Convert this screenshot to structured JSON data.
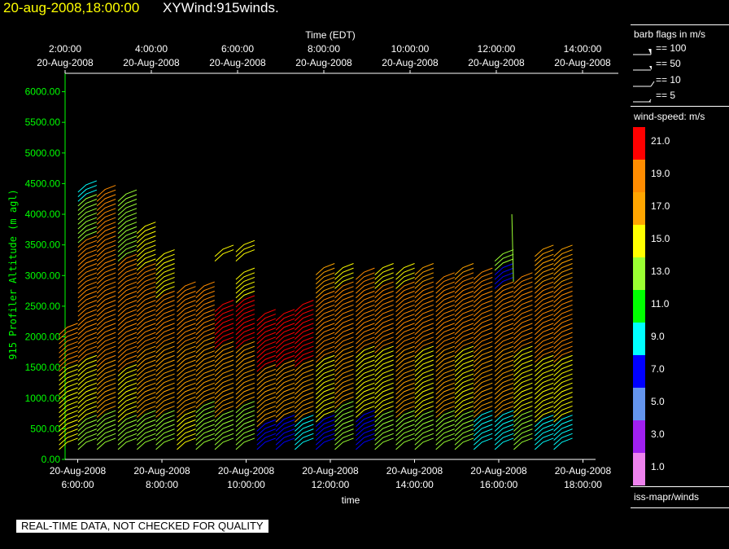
{
  "header": {
    "datetime": "20-aug-2008,18:00:00",
    "product": "XYWind:915winds."
  },
  "colors": {
    "background": "#000000",
    "axis": "#ffffff",
    "yaxis": "#00ff00",
    "title_date": "#ffff00"
  },
  "chart_data": {
    "type": "wind_barbs",
    "top_axis": {
      "title": "Time (EDT)",
      "ticks": [
        {
          "time": "2:00:00",
          "date": "20-Aug-2008"
        },
        {
          "time": "4:00:00",
          "date": "20-Aug-2008"
        },
        {
          "time": "6:00:00",
          "date": "20-Aug-2008"
        },
        {
          "time": "8:00:00",
          "date": "20-Aug-2008"
        },
        {
          "time": "10:00:00",
          "date": "20-Aug-2008"
        },
        {
          "time": "12:00:00",
          "date": "20-Aug-2008"
        },
        {
          "time": "14:00:00",
          "date": "20-Aug-2008"
        }
      ]
    },
    "bottom_axis": {
      "title": "time",
      "ticks": [
        {
          "date": "20-Aug-2008",
          "time": "6:00:00"
        },
        {
          "date": "20-Aug-2008",
          "time": "8:00:00"
        },
        {
          "date": "20-Aug-2008",
          "time": "10:00:00"
        },
        {
          "date": "20-Aug-2008",
          "time": "12:00:00"
        },
        {
          "date": "20-Aug-2008",
          "time": "14:00:00"
        },
        {
          "date": "20-Aug-2008",
          "time": "16:00:00"
        },
        {
          "date": "20-Aug-2008",
          "time": "18:00:00"
        }
      ],
      "xlim_hours": [
        5.7,
        18.3
      ]
    },
    "y_axis": {
      "label": "915 Profiler Altitude (m agl)",
      "ticks": [
        "0.00",
        "500.00",
        "1000.00",
        "1500.00",
        "2000.00",
        "2500.00",
        "3000.00",
        "3500.00",
        "4000.00",
        "4500.00",
        "5000.00",
        "5500.00",
        "6000.00"
      ],
      "ylim": [
        0,
        6300
      ]
    },
    "profiles": [
      {
        "t": 5.75,
        "top": 2200,
        "zones": [
          [
            0,
            1500,
            15
          ],
          [
            1500,
            2200,
            18
          ]
        ]
      },
      {
        "t": 6.2,
        "top": 4500,
        "zones": [
          [
            0,
            700,
            13
          ],
          [
            700,
            1700,
            15
          ],
          [
            1700,
            3600,
            18
          ],
          [
            3600,
            4300,
            13
          ],
          [
            4300,
            4500,
            9
          ]
        ]
      },
      {
        "t": 6.65,
        "top": 4450,
        "zones": [
          [
            0,
            800,
            13
          ],
          [
            800,
            1600,
            16
          ],
          [
            1600,
            3400,
            19
          ],
          [
            3400,
            4450,
            18
          ]
        ]
      },
      {
        "t": 7.15,
        "top": 4400,
        "zones": [
          [
            0,
            700,
            13
          ],
          [
            700,
            1500,
            15
          ],
          [
            1500,
            3300,
            18
          ],
          [
            3300,
            3900,
            13
          ],
          [
            3900,
            4400,
            12
          ]
        ]
      },
      {
        "t": 7.6,
        "top": 3850,
        "zones": [
          [
            0,
            800,
            13
          ],
          [
            800,
            1800,
            16
          ],
          [
            1800,
            3200,
            18
          ],
          [
            3200,
            3850,
            14
          ]
        ]
      },
      {
        "t": 8.05,
        "top": 3400,
        "zones": [
          [
            0,
            800,
            13
          ],
          [
            800,
            1900,
            16
          ],
          [
            1900,
            2700,
            18
          ],
          [
            2700,
            3400,
            15
          ]
        ]
      },
      {
        "t": 8.55,
        "top": 2850,
        "zones": [
          [
            0,
            800,
            14
          ],
          [
            800,
            1900,
            17
          ],
          [
            1900,
            2850,
            19
          ]
        ]
      },
      {
        "t": 9.0,
        "top": 2900,
        "zones": [
          [
            0,
            900,
            13
          ],
          [
            900,
            2000,
            17
          ],
          [
            2000,
            2900,
            18
          ]
        ]
      },
      {
        "t": 9.45,
        "top": 3500,
        "zones": [
          [
            0,
            800,
            13
          ],
          [
            800,
            1900,
            17
          ],
          [
            1900,
            2600,
            21
          ],
          [
            3300,
            3500,
            15
          ]
        ]
      },
      {
        "t": 9.95,
        "top": 3550,
        "zones": [
          [
            0,
            900,
            13
          ],
          [
            900,
            1900,
            16
          ],
          [
            1900,
            2650,
            21
          ],
          [
            2650,
            3100,
            14
          ],
          [
            3300,
            3550,
            15
          ]
        ]
      },
      {
        "t": 10.45,
        "top": 2400,
        "zones": [
          [
            0,
            600,
            7
          ],
          [
            600,
            1500,
            17
          ],
          [
            1500,
            2400,
            21
          ]
        ]
      },
      {
        "t": 10.9,
        "top": 2450,
        "zones": [
          [
            0,
            700,
            7
          ],
          [
            700,
            1600,
            16
          ],
          [
            1600,
            2450,
            21
          ]
        ]
      },
      {
        "t": 11.35,
        "top": 2600,
        "zones": [
          [
            0,
            700,
            9
          ],
          [
            700,
            1600,
            16
          ],
          [
            1600,
            2600,
            20
          ]
        ]
      },
      {
        "t": 11.85,
        "top": 3200,
        "zones": [
          [
            0,
            700,
            7
          ],
          [
            700,
            1700,
            15
          ],
          [
            1700,
            2700,
            19
          ],
          [
            2700,
            3200,
            17
          ]
        ]
      },
      {
        "t": 12.3,
        "top": 3200,
        "zones": [
          [
            0,
            900,
            13
          ],
          [
            900,
            1800,
            16
          ],
          [
            1800,
            2900,
            18
          ],
          [
            2900,
            3200,
            15
          ]
        ]
      },
      {
        "t": 12.8,
        "top": 3100,
        "zones": [
          [
            0,
            800,
            7
          ],
          [
            800,
            1800,
            15
          ],
          [
            1800,
            3100,
            18
          ]
        ]
      },
      {
        "t": 13.25,
        "top": 3150,
        "zones": [
          [
            0,
            800,
            13
          ],
          [
            800,
            1800,
            15
          ],
          [
            1800,
            2900,
            18
          ],
          [
            2900,
            3150,
            15
          ]
        ]
      },
      {
        "t": 13.75,
        "top": 3150,
        "zones": [
          [
            0,
            800,
            13
          ],
          [
            800,
            1800,
            16
          ],
          [
            1800,
            2900,
            18
          ],
          [
            2900,
            3150,
            15
          ]
        ]
      },
      {
        "t": 14.2,
        "top": 3200,
        "zones": [
          [
            0,
            800,
            13
          ],
          [
            800,
            1800,
            15
          ],
          [
            1800,
            2900,
            18
          ],
          [
            2900,
            3200,
            16
          ]
        ]
      },
      {
        "t": 14.7,
        "top": 3000,
        "zones": [
          [
            0,
            800,
            13
          ],
          [
            800,
            1800,
            16
          ],
          [
            1800,
            3000,
            18
          ]
        ]
      },
      {
        "t": 15.15,
        "top": 3150,
        "zones": [
          [
            0,
            800,
            13
          ],
          [
            800,
            1800,
            15
          ],
          [
            1800,
            3000,
            18
          ],
          [
            3000,
            3150,
            16
          ]
        ]
      },
      {
        "t": 15.6,
        "top": 3100,
        "zones": [
          [
            0,
            800,
            9
          ],
          [
            800,
            1800,
            16
          ],
          [
            1800,
            3100,
            19
          ]
        ]
      },
      {
        "t": 16.1,
        "top": 3400,
        "zones": [
          [
            0,
            800,
            9
          ],
          [
            800,
            1800,
            16
          ],
          [
            1800,
            2900,
            18
          ],
          [
            2900,
            3200,
            7
          ],
          [
            3200,
            3400,
            13
          ]
        ]
      },
      {
        "t": 16.55,
        "top": 3000,
        "zones": [
          [
            0,
            800,
            13
          ],
          [
            800,
            1800,
            15
          ],
          [
            1800,
            3000,
            18
          ]
        ]
      },
      {
        "t": 17.05,
        "top": 3500,
        "zones": [
          [
            0,
            700,
            9
          ],
          [
            700,
            1700,
            15
          ],
          [
            1700,
            2900,
            18
          ],
          [
            2900,
            3500,
            16
          ]
        ]
      },
      {
        "t": 17.5,
        "top": 3500,
        "zones": [
          [
            0,
            700,
            9
          ],
          [
            700,
            1700,
            15
          ],
          [
            1700,
            2900,
            18
          ],
          [
            2900,
            3500,
            16
          ]
        ]
      }
    ],
    "spike": {
      "t": 16.35,
      "from": 2900,
      "to": 4000,
      "speed": 12
    }
  },
  "legend": {
    "barb_title": "barb flags in m/s",
    "barb_items": [
      "== 100",
      "== 50",
      "== 10",
      "== 5"
    ],
    "speed_title": "wind-speed: m/s",
    "speed_bins": [
      {
        "label": "21.0",
        "color": "#ff0000"
      },
      {
        "label": "19.0",
        "color": "#ff8c00"
      },
      {
        "label": "17.0",
        "color": "#ffa500"
      },
      {
        "label": "15.0",
        "color": "#ffff00"
      },
      {
        "label": "13.0",
        "color": "#9aff32"
      },
      {
        "label": "11.0",
        "color": "#00ff00"
      },
      {
        "label": "9.0",
        "color": "#00ffff"
      },
      {
        "label": "7.0",
        "color": "#0000ff"
      },
      {
        "label": "5.0",
        "color": "#6495ed"
      },
      {
        "label": "3.0",
        "color": "#a020f0"
      },
      {
        "label": "1.0",
        "color": "#ee82ee"
      }
    ],
    "source": "iss-mapr/winds"
  },
  "footer": {
    "qc_note": "REAL-TIME DATA, NOT CHECKED FOR QUALITY"
  }
}
